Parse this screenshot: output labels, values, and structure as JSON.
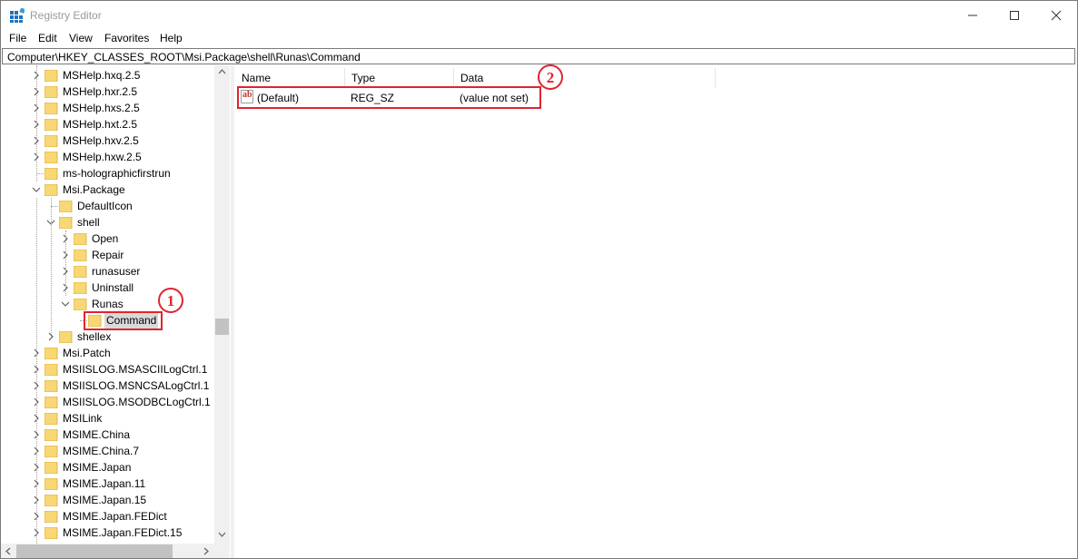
{
  "window": {
    "title": "Registry Editor",
    "controls": {
      "minimize": "—",
      "maximize": "☐",
      "close": "✕"
    }
  },
  "menu": [
    "File",
    "Edit",
    "View",
    "Favorites",
    "Help"
  ],
  "address": "Computer\\HKEY_CLASSES_ROOT\\Msi.Package\\shell\\Runas\\Command",
  "tree": [
    {
      "label": "MSHelp.hxq.2.5",
      "level": 0,
      "expander": "collapsed"
    },
    {
      "label": "MSHelp.hxr.2.5",
      "level": 0,
      "expander": "collapsed"
    },
    {
      "label": "MSHelp.hxs.2.5",
      "level": 0,
      "expander": "collapsed"
    },
    {
      "label": "MSHelp.hxt.2.5",
      "level": 0,
      "expander": "collapsed"
    },
    {
      "label": "MSHelp.hxv.2.5",
      "level": 0,
      "expander": "collapsed"
    },
    {
      "label": "MSHelp.hxw.2.5",
      "level": 0,
      "expander": "collapsed"
    },
    {
      "label": "ms-holographicfirstrun",
      "level": 0,
      "expander": "none"
    },
    {
      "label": "Msi.Package",
      "level": 0,
      "expander": "expanded"
    },
    {
      "label": "DefaultIcon",
      "level": 1,
      "expander": "none"
    },
    {
      "label": "shell",
      "level": 1,
      "expander": "expanded"
    },
    {
      "label": "Open",
      "level": 2,
      "expander": "collapsed"
    },
    {
      "label": "Repair",
      "level": 2,
      "expander": "collapsed"
    },
    {
      "label": "runasuser",
      "level": 2,
      "expander": "collapsed"
    },
    {
      "label": "Uninstall",
      "level": 2,
      "expander": "collapsed"
    },
    {
      "label": "Runas",
      "level": 2,
      "expander": "expanded"
    },
    {
      "label": "Command",
      "level": 3,
      "expander": "none",
      "selected": true
    },
    {
      "label": "shellex",
      "level": 1,
      "expander": "collapsed"
    },
    {
      "label": "Msi.Patch",
      "level": 0,
      "expander": "collapsed"
    },
    {
      "label": "MSIISLOG.MSASCIILogCtrl.1",
      "level": 0,
      "expander": "collapsed"
    },
    {
      "label": "MSIISLOG.MSNCSALogCtrl.1",
      "level": 0,
      "expander": "collapsed"
    },
    {
      "label": "MSIISLOG.MSODBCLogCtrl.1",
      "level": 0,
      "expander": "collapsed"
    },
    {
      "label": "MSILink",
      "level": 0,
      "expander": "collapsed"
    },
    {
      "label": "MSIME.China",
      "level": 0,
      "expander": "collapsed"
    },
    {
      "label": "MSIME.China.7",
      "level": 0,
      "expander": "collapsed"
    },
    {
      "label": "MSIME.Japan",
      "level": 0,
      "expander": "collapsed"
    },
    {
      "label": "MSIME.Japan.11",
      "level": 0,
      "expander": "collapsed"
    },
    {
      "label": "MSIME.Japan.15",
      "level": 0,
      "expander": "collapsed"
    },
    {
      "label": "MSIME.Japan.FEDict",
      "level": 0,
      "expander": "collapsed"
    },
    {
      "label": "MSIME.Japan.FEDict.15",
      "level": 0,
      "expander": "collapsed"
    }
  ],
  "list": {
    "columns": [
      "Name",
      "Type",
      "Data"
    ],
    "rows": [
      {
        "icon": "ab",
        "name": "(Default)",
        "type": "REG_SZ",
        "data": "(value not set)"
      }
    ]
  },
  "annotations": [
    "1",
    "2"
  ],
  "colors": {
    "highlight": "#e0242f",
    "folder": "#f8d775",
    "selection": "#d9d9d9"
  }
}
